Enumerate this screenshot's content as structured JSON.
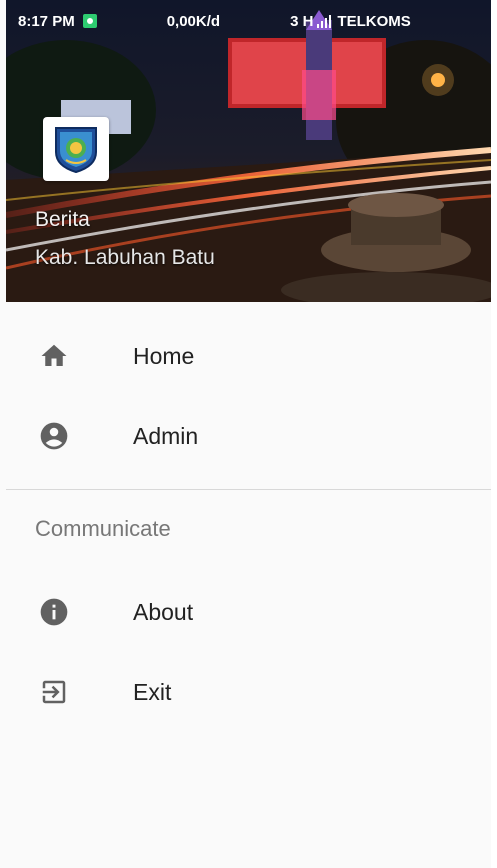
{
  "status_bar": {
    "time": "8:17 PM",
    "speed": "0,00K/d",
    "network": "3 H",
    "carrier": "TELKOMS"
  },
  "header": {
    "title": "Berita",
    "subtitle": "Kab. Labuhan Batu",
    "logo_icon": "regency-emblem-icon"
  },
  "menu": {
    "items": [
      {
        "label": "Home",
        "icon": "home-icon"
      },
      {
        "label": "Admin",
        "icon": "account-circle-icon"
      }
    ],
    "section_title": "Communicate",
    "section_items": [
      {
        "label": "About",
        "icon": "info-icon"
      },
      {
        "label": "Exit",
        "icon": "exit-icon"
      }
    ]
  },
  "colors": {
    "icon": "#616161",
    "text": "#222222",
    "section_text": "#777777",
    "divider": "#d8d8d8",
    "drawer_bg": "#fafafa"
  }
}
